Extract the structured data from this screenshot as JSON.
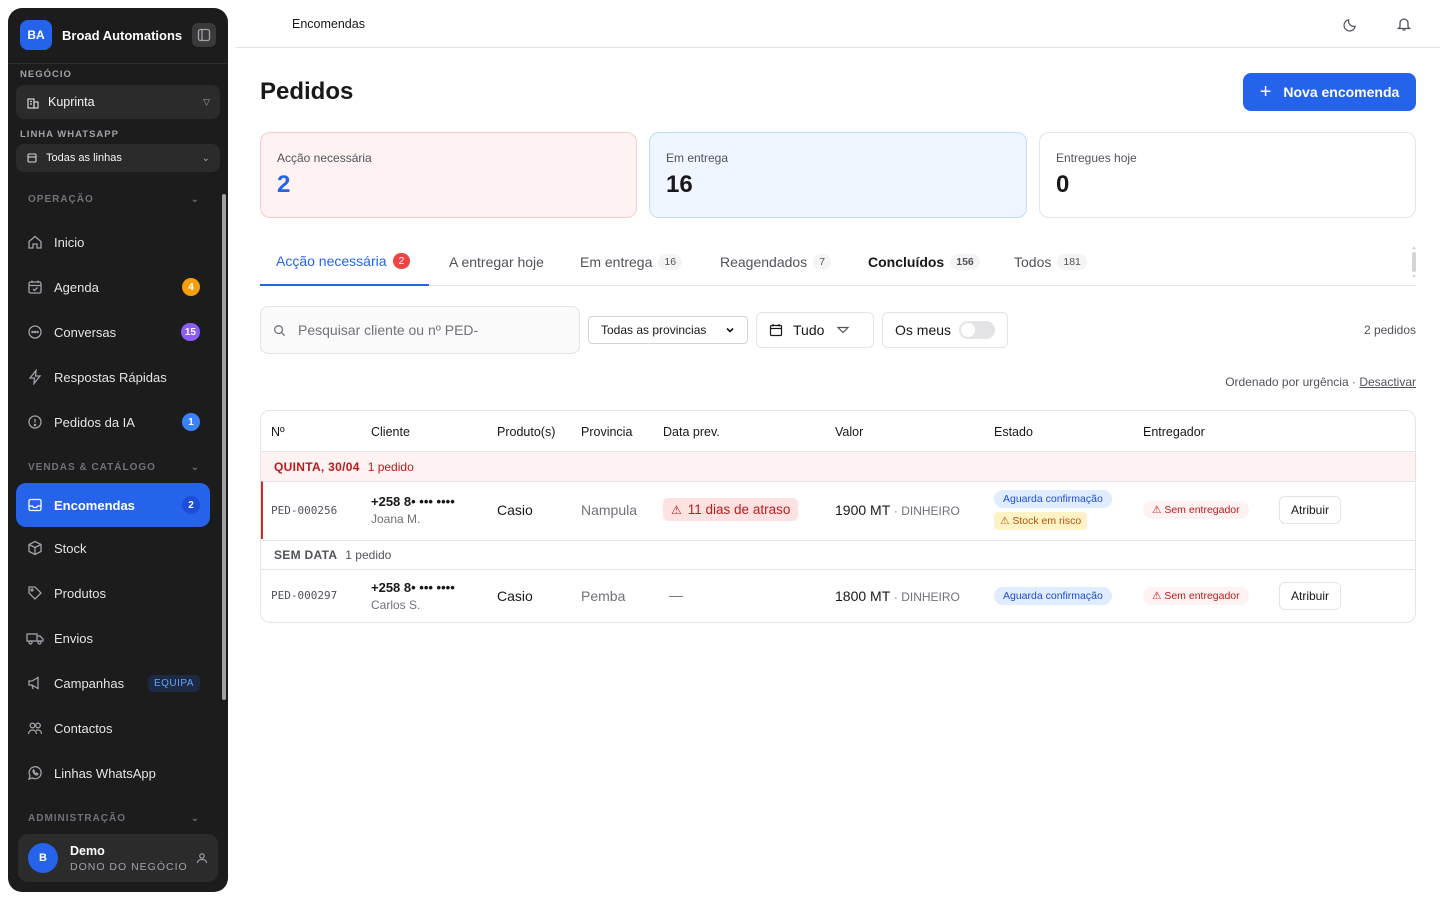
{
  "brand": {
    "initials": "BA",
    "name": "Broad Automations"
  },
  "sidebar": {
    "business_label": "NEGÓCIO",
    "business_value": "Kuprinta",
    "line_label": "LINHA WHATSAPP",
    "line_value": "Todas as linhas",
    "groups": {
      "operation": "OPERAÇÃO",
      "sales": "VENDAS & CATÁLOGO",
      "admin": "ADMINISTRAÇÃO"
    },
    "items": [
      {
        "label": "Inicio",
        "icon": "home-icon"
      },
      {
        "label": "Agenda",
        "icon": "calendar-icon",
        "badge": "4",
        "badge_color": "#f59e0b"
      },
      {
        "label": "Conversas",
        "icon": "chat-icon",
        "badge": "15",
        "badge_color": "#8b5cf6"
      },
      {
        "label": "Respostas Rápidas",
        "icon": "lightning-icon"
      },
      {
        "label": "Pedidos da IA",
        "icon": "info-icon",
        "badge": "1",
        "badge_color": "#3b82f6"
      },
      {
        "label": "Encomendas",
        "icon": "inbox-icon",
        "badge": "2",
        "badge_color": "#1d4ed8"
      },
      {
        "label": "Stock",
        "icon": "box-icon"
      },
      {
        "label": "Produtos",
        "icon": "tag-icon"
      },
      {
        "label": "Envios",
        "icon": "truck-icon"
      },
      {
        "label": "Campanhas",
        "icon": "megaphone-icon",
        "tag": "EQUIPA"
      },
      {
        "label": "Contactos",
        "icon": "users-icon"
      },
      {
        "label": "Linhas WhatsApp",
        "icon": "whatsapp-icon"
      }
    ]
  },
  "user": {
    "initials": "B",
    "name": "Demo",
    "role": "DONO DO NEGÓCIO"
  },
  "topbar": {
    "breadcrumb": "Encomendas"
  },
  "page": {
    "title": "Pedidos",
    "new_button": "Nova encomenda"
  },
  "stats": [
    {
      "label": "Acção necessária",
      "value": "2"
    },
    {
      "label": "Em entrega",
      "value": "16"
    },
    {
      "label": "Entregues hoje",
      "value": "0"
    }
  ],
  "tabs": [
    {
      "label": "Acção necessária",
      "count": "2"
    },
    {
      "label": "A entregar hoje",
      "count": ""
    },
    {
      "label": "Em entrega",
      "count": "16"
    },
    {
      "label": "Reagendados",
      "count": "7"
    },
    {
      "label": "Concluídos",
      "count": "156"
    },
    {
      "label": "Todos",
      "count": "181"
    }
  ],
  "filters": {
    "search_placeholder": "Pesquisar cliente ou nº PED-",
    "province": "Todas as provincias",
    "date": "Tudo",
    "mine": "Os meus",
    "mine_on": false,
    "result_count": "2 pedidos",
    "sort_text": "Ordenado por urgência ·",
    "sort_link": "Desactivar"
  },
  "table": {
    "columns": [
      "Nº",
      "Cliente",
      "Produto(s)",
      "Provincia",
      "Data prev.",
      "Valor",
      "Estado",
      "Entregador"
    ],
    "groups": [
      {
        "title": "QUINTA, 30/04",
        "count": "1 pedido"
      },
      {
        "title": "SEM DATA",
        "count": "1 pedido"
      }
    ],
    "rows": [
      {
        "id": "PED-000256",
        "phone": "+258 8• ••• ••••",
        "name": "Joana M.",
        "product": "Casio",
        "province": "Nampula",
        "date": "11 dias de atraso",
        "value": "1900 MT",
        "method": "· DINHEIRO",
        "status": "Aguarda confirmação",
        "status2": "Stock em risco",
        "courier": "Sem entregador",
        "action": "Atribuir"
      },
      {
        "id": "PED-000297",
        "phone": "+258 8• ••• ••••",
        "name": "Carlos S.",
        "product": "Casio",
        "province": "Pemba",
        "date": "—",
        "value": "1800 MT",
        "method": "· DINHEIRO",
        "status": "Aguarda confirmação",
        "courier": "Sem entregador",
        "action": "Atribuir"
      }
    ]
  }
}
